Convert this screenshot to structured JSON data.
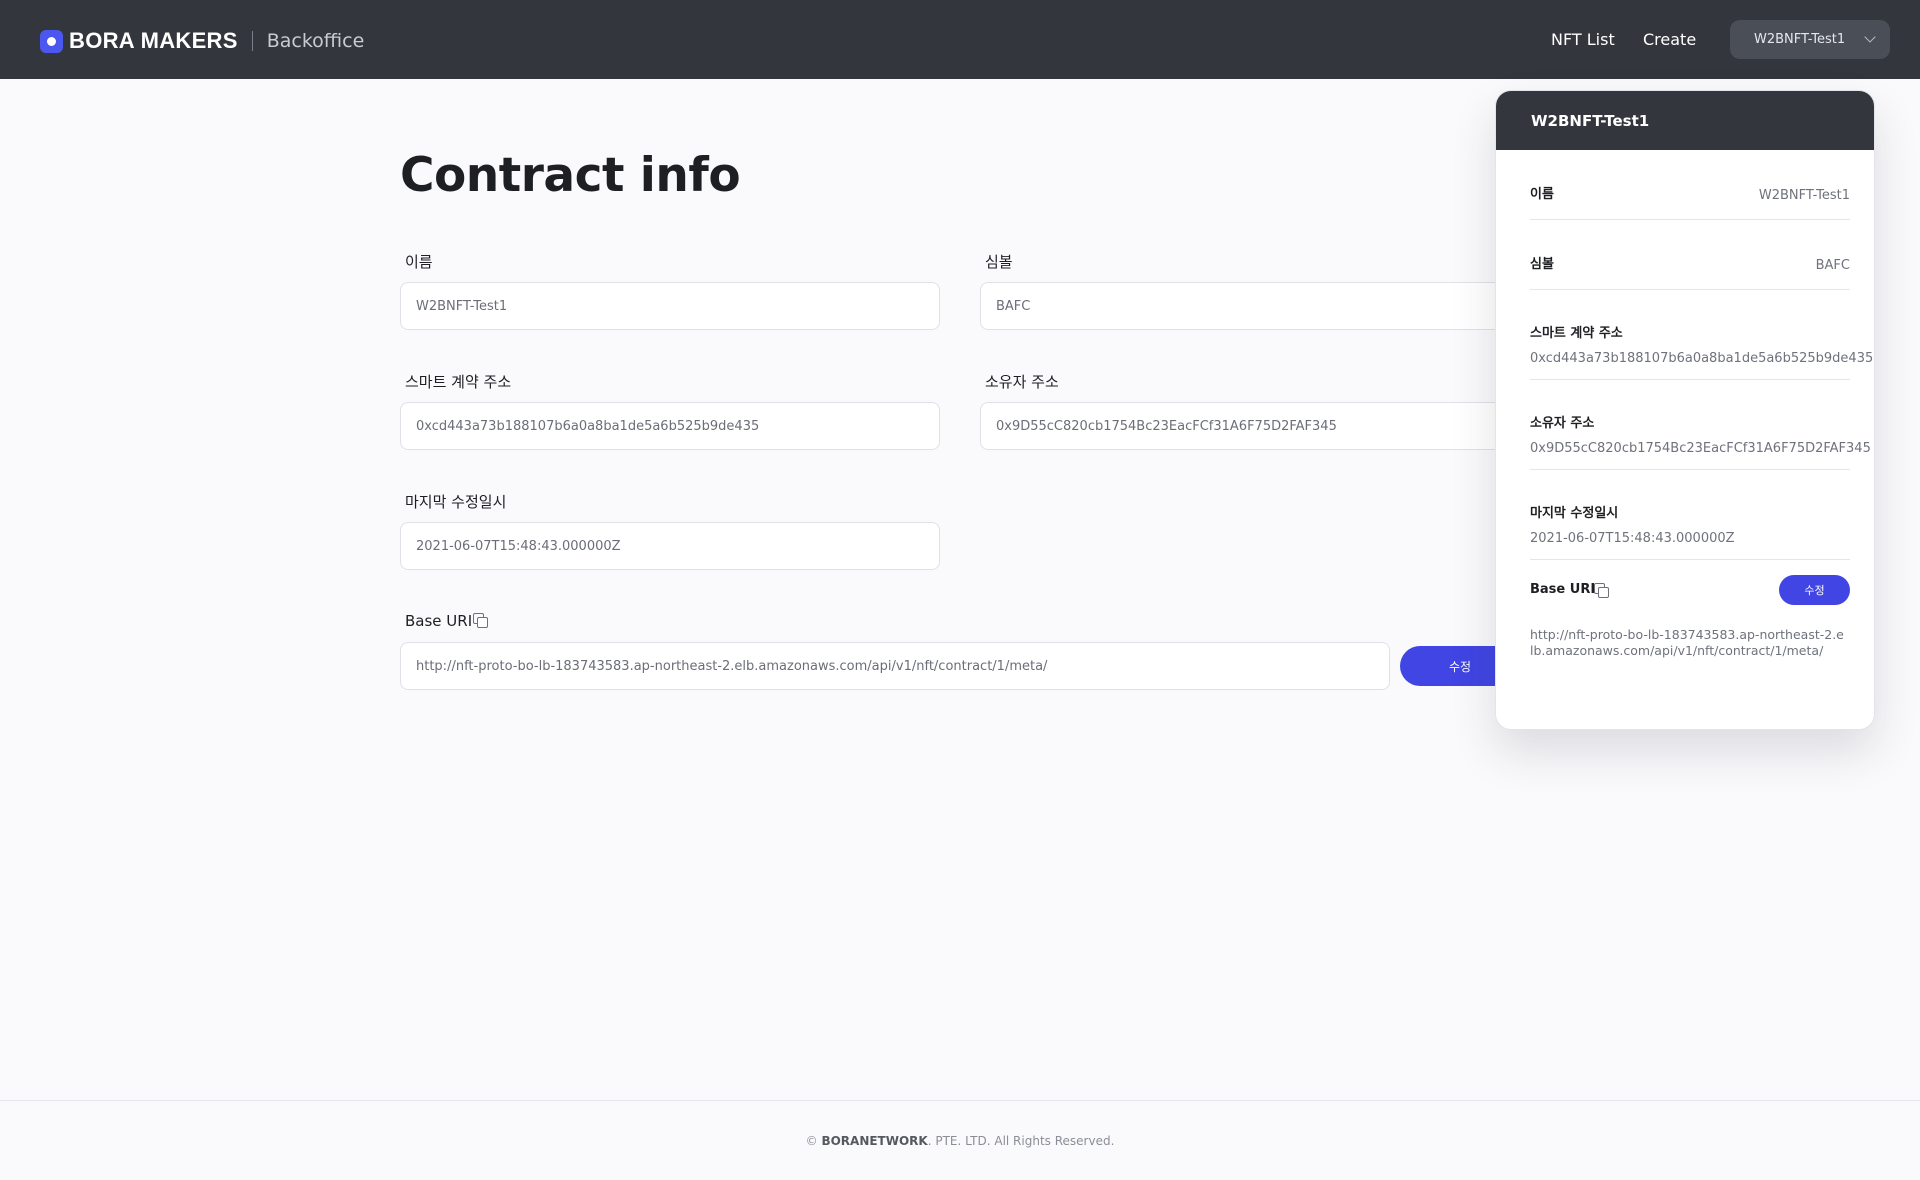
{
  "header": {
    "brand": "BORA MAKERS",
    "brand_sub": "Backoffice",
    "nav": {
      "nft_list": "NFT List",
      "create": "Create"
    },
    "account": "W2BNFT-Test1"
  },
  "main": {
    "title": "Contract info",
    "fields": {
      "name": {
        "label": "이름",
        "value": "W2BNFT-Test1"
      },
      "symbol": {
        "label": "심볼",
        "value": "BAFC"
      },
      "contract_address": {
        "label": "스마트 계약 주소",
        "value": "0xcd443a73b188107b6a0a8ba1de5a6b525b9de435"
      },
      "owner_address": {
        "label": "소유자 주소",
        "value": "0x9D55cC820cb1754Bc23EacFCf31A6F75D2FAF345"
      },
      "last_modified": {
        "label": "마지막 수정일시",
        "value": "2021-06-07T15:48:43.000000Z"
      },
      "base_uri": {
        "label": "Base URI",
        "value": "http://nft-proto-bo-lb-183743583.ap-northeast-2.elb.amazonaws.com/api/v1/nft/contract/1/meta/"
      }
    },
    "edit_label": "수정"
  },
  "panel": {
    "title": "W2BNFT-Test1",
    "name": {
      "label": "이름",
      "value": "W2BNFT-Test1"
    },
    "symbol": {
      "label": "심볼",
      "value": "BAFC"
    },
    "contract_address": {
      "label": "스마트 계약 주소",
      "value": "0xcd443a73b188107b6a0a8ba1de5a6b525b9de435"
    },
    "owner_address": {
      "label": "소유자 주소",
      "value": "0x9D55cC820cb1754Bc23EacFCf31A6F75D2FAF345"
    },
    "last_modified": {
      "label": "마지막 수정일시",
      "value": "2021-06-07T15:48:43.000000Z"
    },
    "base_uri": {
      "label": "Base URI",
      "value": "http://nft-proto-bo-lb-183743583.ap-northeast-2.elb.amazonaws.com/api/v1/nft/contract/1/meta/"
    },
    "edit_label": "수정"
  },
  "footer": {
    "copyright_prefix": "©",
    "company": "BORANETWORK",
    "rights": ". PTE. LTD. All Rights Reserved."
  },
  "colors": {
    "header_bg": "#33363c",
    "accent": "#4045e3",
    "page_bg": "#fafafc"
  }
}
